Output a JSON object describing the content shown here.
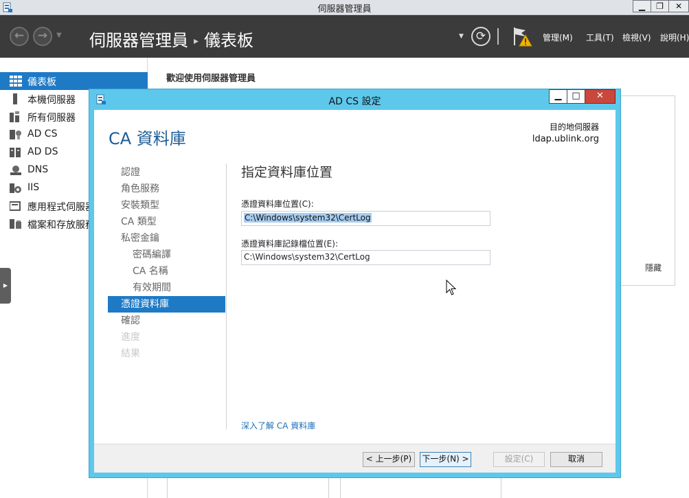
{
  "window": {
    "title": "伺服器管理員",
    "minimize": "▁",
    "restore": "❐",
    "close": "✕"
  },
  "header": {
    "breadcrumb_app": "伺服器管理員",
    "breadcrumb_page": "儀表板",
    "menus": [
      "管理(M)",
      "工具(T)",
      "檢視(V)",
      "說明(H)"
    ],
    "back_glyph": "←",
    "forward_glyph": "→",
    "refresh_glyph": "⟳"
  },
  "sidebar": {
    "items": [
      {
        "label": "儀表板",
        "icon": "dashboard-icon",
        "active": true
      },
      {
        "label": "本機伺服器",
        "icon": "server-icon"
      },
      {
        "label": "所有伺服器",
        "icon": "servers-icon"
      },
      {
        "label": "AD CS",
        "icon": "adcs-icon"
      },
      {
        "label": "AD DS",
        "icon": "adds-icon"
      },
      {
        "label": "DNS",
        "icon": "dns-icon"
      },
      {
        "label": "IIS",
        "icon": "iis-icon"
      },
      {
        "label": "應用程式伺服器",
        "icon": "app-server-icon"
      },
      {
        "label": "檔案和存放服務",
        "icon": "file-storage-icon"
      }
    ],
    "handle_glyph": "▶"
  },
  "main": {
    "welcome": "歡迎使用伺服器管理員",
    "hide": "隱藏"
  },
  "dialog": {
    "title": "AD CS 設定",
    "heading": "CA 資料庫",
    "destination_label": "目的地伺服器",
    "destination_host": "ldap.ublink.org",
    "steps": [
      {
        "label": "認證",
        "state": "normal"
      },
      {
        "label": "角色服務",
        "state": "normal"
      },
      {
        "label": "安裝類型",
        "state": "normal"
      },
      {
        "label": "CA 類型",
        "state": "normal"
      },
      {
        "label": "私密金鑰",
        "state": "normal"
      },
      {
        "label": "密碼編譯",
        "state": "sub"
      },
      {
        "label": "CA 名稱",
        "state": "sub"
      },
      {
        "label": "有效期間",
        "state": "sub"
      },
      {
        "label": "憑證資料庫",
        "state": "active"
      },
      {
        "label": "確認",
        "state": "normal"
      },
      {
        "label": "進度",
        "state": "disabled"
      },
      {
        "label": "結果",
        "state": "disabled"
      }
    ],
    "section_title": "指定資料庫位置",
    "db_label": "憑證資料庫位置(C):",
    "db_value": "C:\\Windows\\system32\\CertLog",
    "log_label": "憑證資料庫記錄檔位置(E):",
    "log_value": "C:\\Windows\\system32\\CertLog",
    "learn_more": "深入了解 CA 資料庫",
    "buttons": {
      "prev": "< 上一步(P)",
      "next": "下一步(N) >",
      "configure": "設定(C)",
      "cancel": "取消"
    }
  },
  "colors": {
    "accent": "#1f7ac6",
    "dialog_frame": "#5ec8ec",
    "header_bg": "#3b3b3b",
    "heading": "#1c5d95",
    "warning": "#f2b400",
    "close": "#c9483d"
  }
}
